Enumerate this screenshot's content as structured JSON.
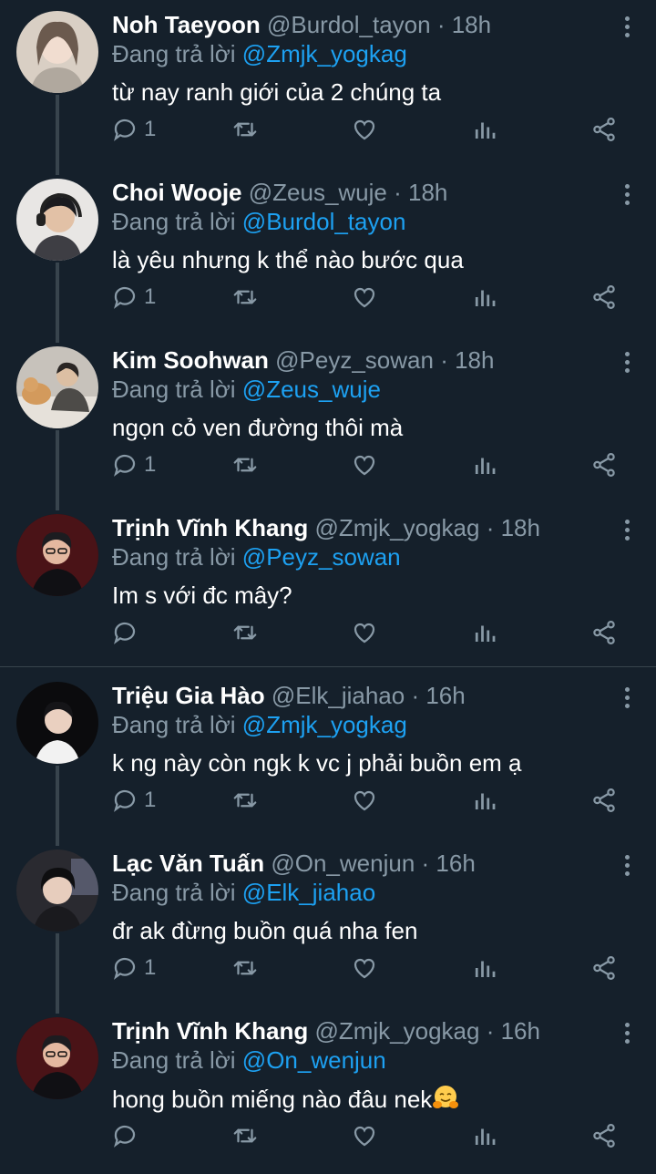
{
  "reply_prefix": "Đang trả lời",
  "tweets": [
    {
      "name": "Noh Taeyoon",
      "handle": "@Burdol_tayon",
      "time": "· 18h",
      "reply_to": "@Zmjk_yogkag",
      "text": "từ nay ranh giới của 2 chúng ta",
      "replies": "1"
    },
    {
      "name": "Choi Wooje",
      "handle": "@Zeus_wuje",
      "time": "· 18h",
      "reply_to": "@Burdol_tayon",
      "text": "là yêu nhưng k thể nào bước qua",
      "replies": "1"
    },
    {
      "name": "Kim Soohwan",
      "handle": "@Peyz_sowan",
      "time": "· 18h",
      "reply_to": "@Zeus_wuje",
      "text": "ngọn cỏ ven đường thôi mà",
      "replies": "1"
    },
    {
      "name": "Trịnh Vĩnh Khang",
      "handle": "@Zmjk_yogkag",
      "time": "· 18h",
      "reply_to": "@Peyz_sowan",
      "text": "Im s với đc mây?",
      "replies": ""
    },
    {
      "name": "Triệu Gia Hào",
      "handle": "@Elk_jiahao",
      "time": "· 16h",
      "reply_to": "@Zmjk_yogkag",
      "text": "k ng này còn ngk k vc j phải buồn em ạ",
      "replies": "1"
    },
    {
      "name": "Lạc Văn Tuấn",
      "handle": "@On_wenjun",
      "time": "· 16h",
      "reply_to": "@Elk_jiahao",
      "text": "đr ak đừng buồn quá nha fen",
      "replies": "1"
    },
    {
      "name": "Trịnh Vĩnh Khang",
      "handle": "@Zmjk_yogkag",
      "time": "· 16h",
      "reply_to": "@On_wenjun",
      "text": "hong buồn miếng nào đâu nek",
      "replies": ""
    }
  ],
  "colors": {
    "background": "#15202b",
    "secondary_text": "#8899a6",
    "mention": "#1da1f2",
    "thread_line": "#38444d"
  },
  "icons": [
    "reply-icon",
    "retweet-icon",
    "like-icon",
    "analytics-icon",
    "share-icon",
    "more-options-icon",
    "hugging-face-emoji"
  ]
}
